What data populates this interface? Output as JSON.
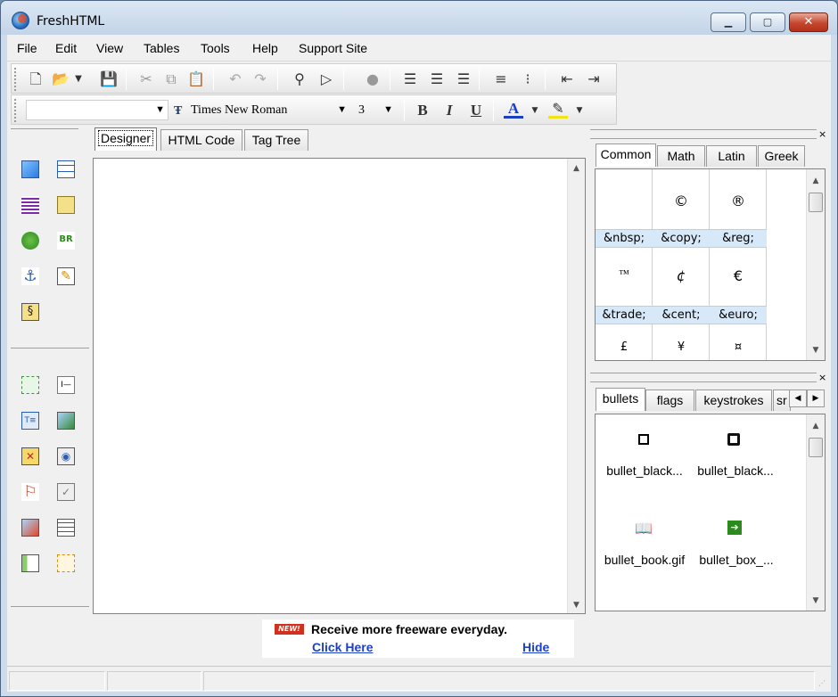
{
  "window": {
    "title": "FreshHTML"
  },
  "menu": [
    "File",
    "Edit",
    "View",
    "Tables",
    "Tools",
    "Help",
    "Support Site"
  ],
  "format_bar": {
    "font_name": "Times New Roman",
    "font_size": "3",
    "bold": "B",
    "italic": "I",
    "underline": "U",
    "font_color_letter": "A"
  },
  "editor_tabs": [
    "Designer",
    "HTML Code",
    "Tag Tree"
  ],
  "char_tabs": [
    "Common",
    "Math",
    "Latin",
    "Greek"
  ],
  "char_grid": {
    "row1_glyphs": [
      "",
      "©",
      "®"
    ],
    "row1_entities": [
      "&nbsp;",
      "&copy;",
      "&reg;"
    ],
    "row2_glyphs": [
      "™",
      "¢",
      "€"
    ],
    "row2_entities": [
      "&trade;",
      "&cent;",
      "&euro;"
    ],
    "row3_glyphs": [
      "£",
      "¥",
      "¤"
    ]
  },
  "image_tabs": [
    "bullets",
    "flags",
    "keystrokes",
    "sr"
  ],
  "images": [
    {
      "label": "bullet_black...",
      "icon": "hollow-square-small"
    },
    {
      "label": "bullet_black...",
      "icon": "hollow-square-large"
    },
    {
      "label": "bullet_book.gif",
      "icon": "book-icon"
    },
    {
      "label": "bullet_box_...",
      "icon": "green-arrow-box"
    }
  ],
  "ad": {
    "badge": "NEW!",
    "text": "Receive more freeware everyday.",
    "link": "Click Here",
    "hide": "Hide"
  },
  "colors": {
    "accent": "#1a3fbf",
    "link": "#1c3fc9",
    "entity_bg": "#d7e8f8",
    "close_btn": "#c5462f"
  }
}
